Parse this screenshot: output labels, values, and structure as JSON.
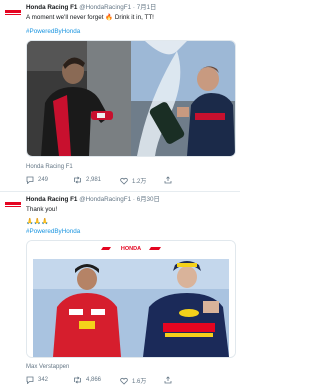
{
  "tweets": [
    {
      "author": "Honda Racing F1",
      "handle": "@HondaRacingF1",
      "time": "7月1日",
      "text": "A moment we'll never forget 🔥 Drink it in, TT!",
      "hashtag": "#PoweredByHonda",
      "media_caption": "Honda Racing F1",
      "stats": {
        "replies": "249",
        "retweets": "2,981",
        "likes": "1.2万"
      }
    },
    {
      "author": "Honda Racing F1",
      "handle": "@HondaRacingF1",
      "time": "6月30日",
      "text": "Thank you!",
      "emoji_line": "🙏🙏🙏",
      "hashtag": "#PoweredByHonda",
      "banner": "HONDA",
      "media_caption": "Max Verstappen",
      "stats": {
        "replies": "342",
        "retweets": "4,866",
        "likes": "1.6万"
      }
    }
  ],
  "colors": {
    "honda_red": "#e40521",
    "link_blue": "#1b95e0",
    "muted": "#657786"
  }
}
